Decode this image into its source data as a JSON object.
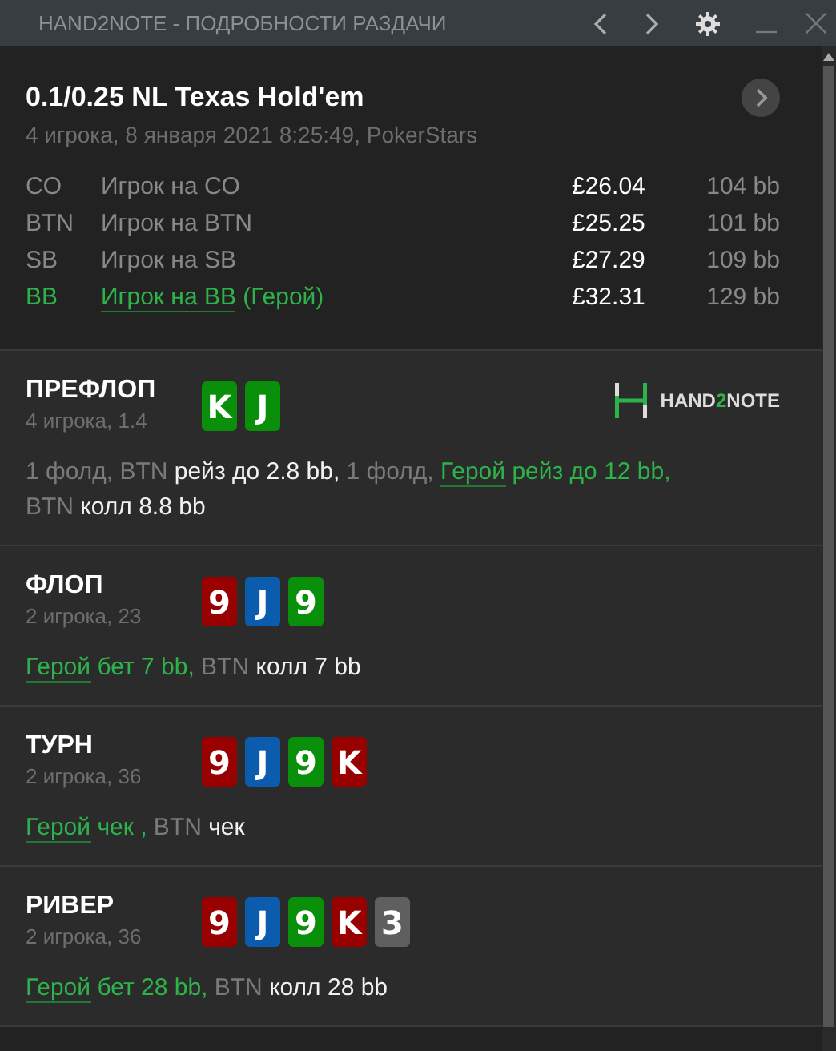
{
  "window": {
    "title": "HAND2NOTE - ПОДРОБНОСТИ РАЗДАЧИ"
  },
  "hand": {
    "title": "0.1/0.25 NL Texas Hold'em",
    "subtitle": "4 игрока, 8 января 2021 8:25:49, PokerStars"
  },
  "players": [
    {
      "position": "CO",
      "name": "Игрок на CO",
      "hero": false,
      "stack": "£26.04",
      "bb": "104 bb"
    },
    {
      "position": "BTN",
      "name": "Игрок на BTN",
      "hero": false,
      "stack": "£25.25",
      "bb": "101 bb"
    },
    {
      "position": "SB",
      "name": "Игрок на SB",
      "hero": false,
      "stack": "£27.29",
      "bb": "109 bb"
    },
    {
      "position": "BB",
      "name": "Игрок на BB",
      "suffix": " (Герой)",
      "hero": true,
      "stack": "£32.31",
      "bb": "129 bb"
    }
  ],
  "logo": [
    {
      "text": "HAND",
      "kind": "plain"
    },
    {
      "text": "2",
      "kind": "accent"
    },
    {
      "text": "NOTE",
      "kind": "plain"
    }
  ],
  "streets": [
    {
      "name": "ПРЕФЛОП",
      "info": "4 игрока, 1.4",
      "logo": true,
      "cards": [
        {
          "rank": "K",
          "color": "#0a8f0a"
        },
        {
          "rank": "J",
          "color": "#0a8f0a"
        }
      ],
      "actions": [
        {
          "text": "1 фолд, BTN ",
          "kind": "muted"
        },
        {
          "text": "рейз до 2.8 bb,",
          "kind": "white"
        },
        {
          "text": " 1 фолд, ",
          "kind": "muted"
        },
        {
          "text": "Герой",
          "kind": "hero"
        },
        {
          "text": " рейз до 12 bb,",
          "kind": "green"
        },
        {
          "text": " BTN ",
          "kind": "muted"
        },
        {
          "text": "колл 8.8 bb",
          "kind": "white"
        }
      ]
    },
    {
      "name": "ФЛОП",
      "info": "2 игрока, 23",
      "logo": false,
      "cards": [
        {
          "rank": "9",
          "color": "#990000"
        },
        {
          "rank": "J",
          "color": "#0b5cad"
        },
        {
          "rank": "9",
          "color": "#0a8f0a"
        }
      ],
      "actions": [
        {
          "text": "Герой",
          "kind": "hero"
        },
        {
          "text": " бет 7 bb,",
          "kind": "green"
        },
        {
          "text": " BTN ",
          "kind": "muted"
        },
        {
          "text": "колл 7 bb",
          "kind": "white"
        }
      ]
    },
    {
      "name": "ТУРН",
      "info": "2 игрока, 36",
      "logo": false,
      "cards": [
        {
          "rank": "9",
          "color": "#990000"
        },
        {
          "rank": "J",
          "color": "#0b5cad"
        },
        {
          "rank": "9",
          "color": "#0a8f0a"
        },
        {
          "rank": "K",
          "color": "#990000"
        }
      ],
      "actions": [
        {
          "text": "Герой",
          "kind": "hero"
        },
        {
          "text": " чек ,",
          "kind": "green"
        },
        {
          "text": " BTN ",
          "kind": "muted"
        },
        {
          "text": "чек",
          "kind": "white"
        }
      ]
    },
    {
      "name": "РИВЕР",
      "info": "2 игрока, 36",
      "logo": false,
      "cards": [
        {
          "rank": "9",
          "color": "#990000"
        },
        {
          "rank": "J",
          "color": "#0b5cad"
        },
        {
          "rank": "9",
          "color": "#0a8f0a"
        },
        {
          "rank": "K",
          "color": "#990000"
        },
        {
          "rank": "3",
          "color": "#5f5f5f"
        }
      ],
      "actions": [
        {
          "text": "Герой",
          "kind": "hero"
        },
        {
          "text": " бет 28 bb,",
          "kind": "green"
        },
        {
          "text": " BTN ",
          "kind": "muted"
        },
        {
          "text": "колл 28 bb",
          "kind": "white"
        }
      ]
    }
  ]
}
